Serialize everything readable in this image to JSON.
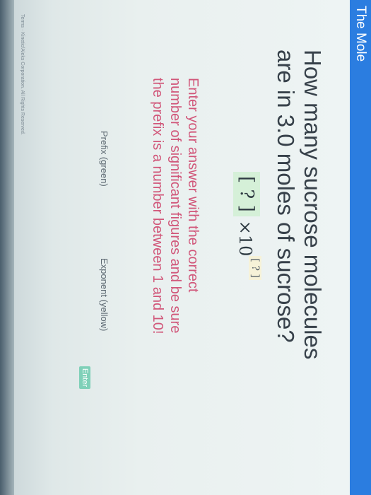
{
  "topbar": {
    "title": "The Mole",
    "color": "#2b7de0"
  },
  "question": {
    "line1": "How many sucrose molecules",
    "line2": "are in 3.0 moles of sucrose?"
  },
  "answer": {
    "prefix_placeholder": "[ ? ]",
    "times_ten": "×10",
    "exponent_placeholder": "[ ? ]",
    "prefix_color": "#d5f0d8",
    "exponent_color": "#f6f2d8"
  },
  "instructions": {
    "line1": "Enter your answer with the correct",
    "line2": "number of significant figures and be sure",
    "line3": "the prefix is a number between 1 and 10!",
    "color": "#d1577a"
  },
  "fields": {
    "prefix_label": "Prefix (green)",
    "exponent_label": "Exponent (yellow)"
  },
  "buttons": {
    "enter_label": "Enter",
    "enter_color": "#7fd0b8"
  },
  "footer": {
    "text": "Terms · Kinetic/Aleks Corporation. All Rights Reserved."
  }
}
